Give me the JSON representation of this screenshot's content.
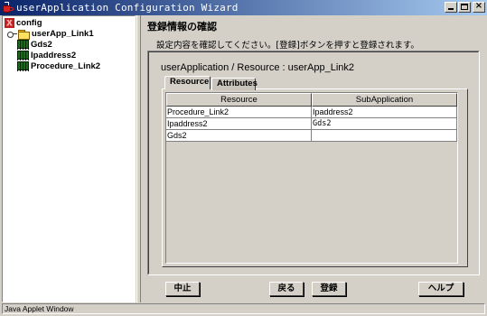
{
  "window": {
    "title": "userApplication Configuration Wizard",
    "icon": "java-cup-icon",
    "controls": {
      "minimize": "_",
      "maximize": "□",
      "close": "×"
    }
  },
  "tree": {
    "root": {
      "label": "config",
      "icon": "config-icon"
    },
    "items": [
      {
        "label": "userApp_Link1",
        "icon": "folder-icon"
      },
      {
        "label": "Gds2",
        "icon": "resource-icon"
      },
      {
        "label": "Ipaddress2",
        "icon": "resource-icon"
      },
      {
        "label": "Procedure_Link2",
        "icon": "resource-icon"
      }
    ]
  },
  "content": {
    "heading": "登録情報の確認",
    "instructions": "設定内容を確認してください。[登録]ボタンを押すと登録されます。",
    "resource_title": "userApplication / Resource  :  userApp_Link2",
    "tabs": [
      {
        "label": "Resource",
        "active": true
      },
      {
        "label": "Attributes",
        "active": false
      }
    ],
    "table": {
      "headers": [
        "Resource",
        "SubApplication"
      ],
      "rows": [
        [
          "Procedure_Link2",
          "Ipaddress2"
        ],
        [
          "Ipaddress2",
          "Gds2"
        ],
        [
          "Gds2",
          ""
        ]
      ]
    }
  },
  "buttons": {
    "cancel": "中止",
    "back": "戻る",
    "register": "登録",
    "help": "ヘルプ"
  },
  "statusbar": {
    "text": "Java Applet Window"
  }
}
